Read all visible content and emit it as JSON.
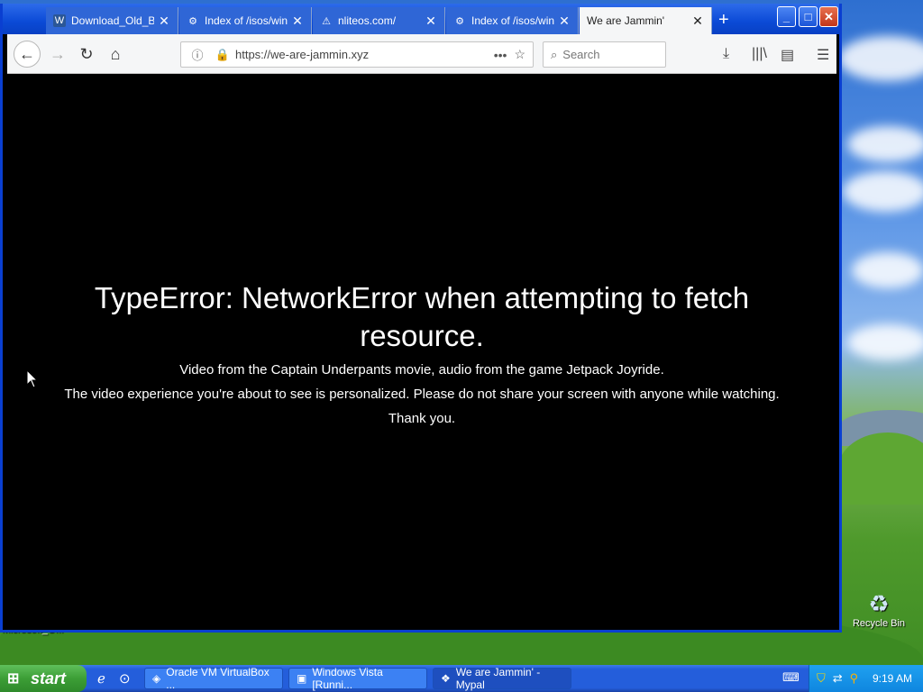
{
  "browser": {
    "tabs": [
      {
        "label": "Download_Old_Bu",
        "favicon": "word-doc-icon"
      },
      {
        "label": "Index of /isos/win",
        "favicon": "apache-icon"
      },
      {
        "label": "nliteos.com/",
        "favicon": "warning-icon"
      },
      {
        "label": "Index of /isos/win",
        "favicon": "apache-icon"
      },
      {
        "label": "We are Jammin'",
        "favicon": ""
      }
    ],
    "url": "https://we-are-jammin.xyz",
    "search_placeholder": "Search"
  },
  "content": {
    "error_title": "TypeError: NetworkError when attempting to fetch resource.",
    "line1": "Video from the Captain Underpants movie, audio from the game Jetpack Joyride.",
    "line2": "The video experience you're about to see is personalized. Please do not share your screen with anyone while watching.",
    "line3": "Thank you."
  },
  "desktop": {
    "recycle_bin_label": "Recycle Bin",
    "partial_icon_label": "Microsoft_O..."
  },
  "taskbar": {
    "start_label": "start",
    "buttons": [
      {
        "label": "Oracle VM VirtualBox ..."
      },
      {
        "label": "Windows Vista [Runni..."
      },
      {
        "label": "We are Jammin' - Mypal"
      }
    ],
    "clock": "9:19 AM"
  },
  "colors": {
    "titlebar_blue": "#0b4ad6",
    "content_bg": "#000000",
    "start_green": "#3c9e36"
  }
}
